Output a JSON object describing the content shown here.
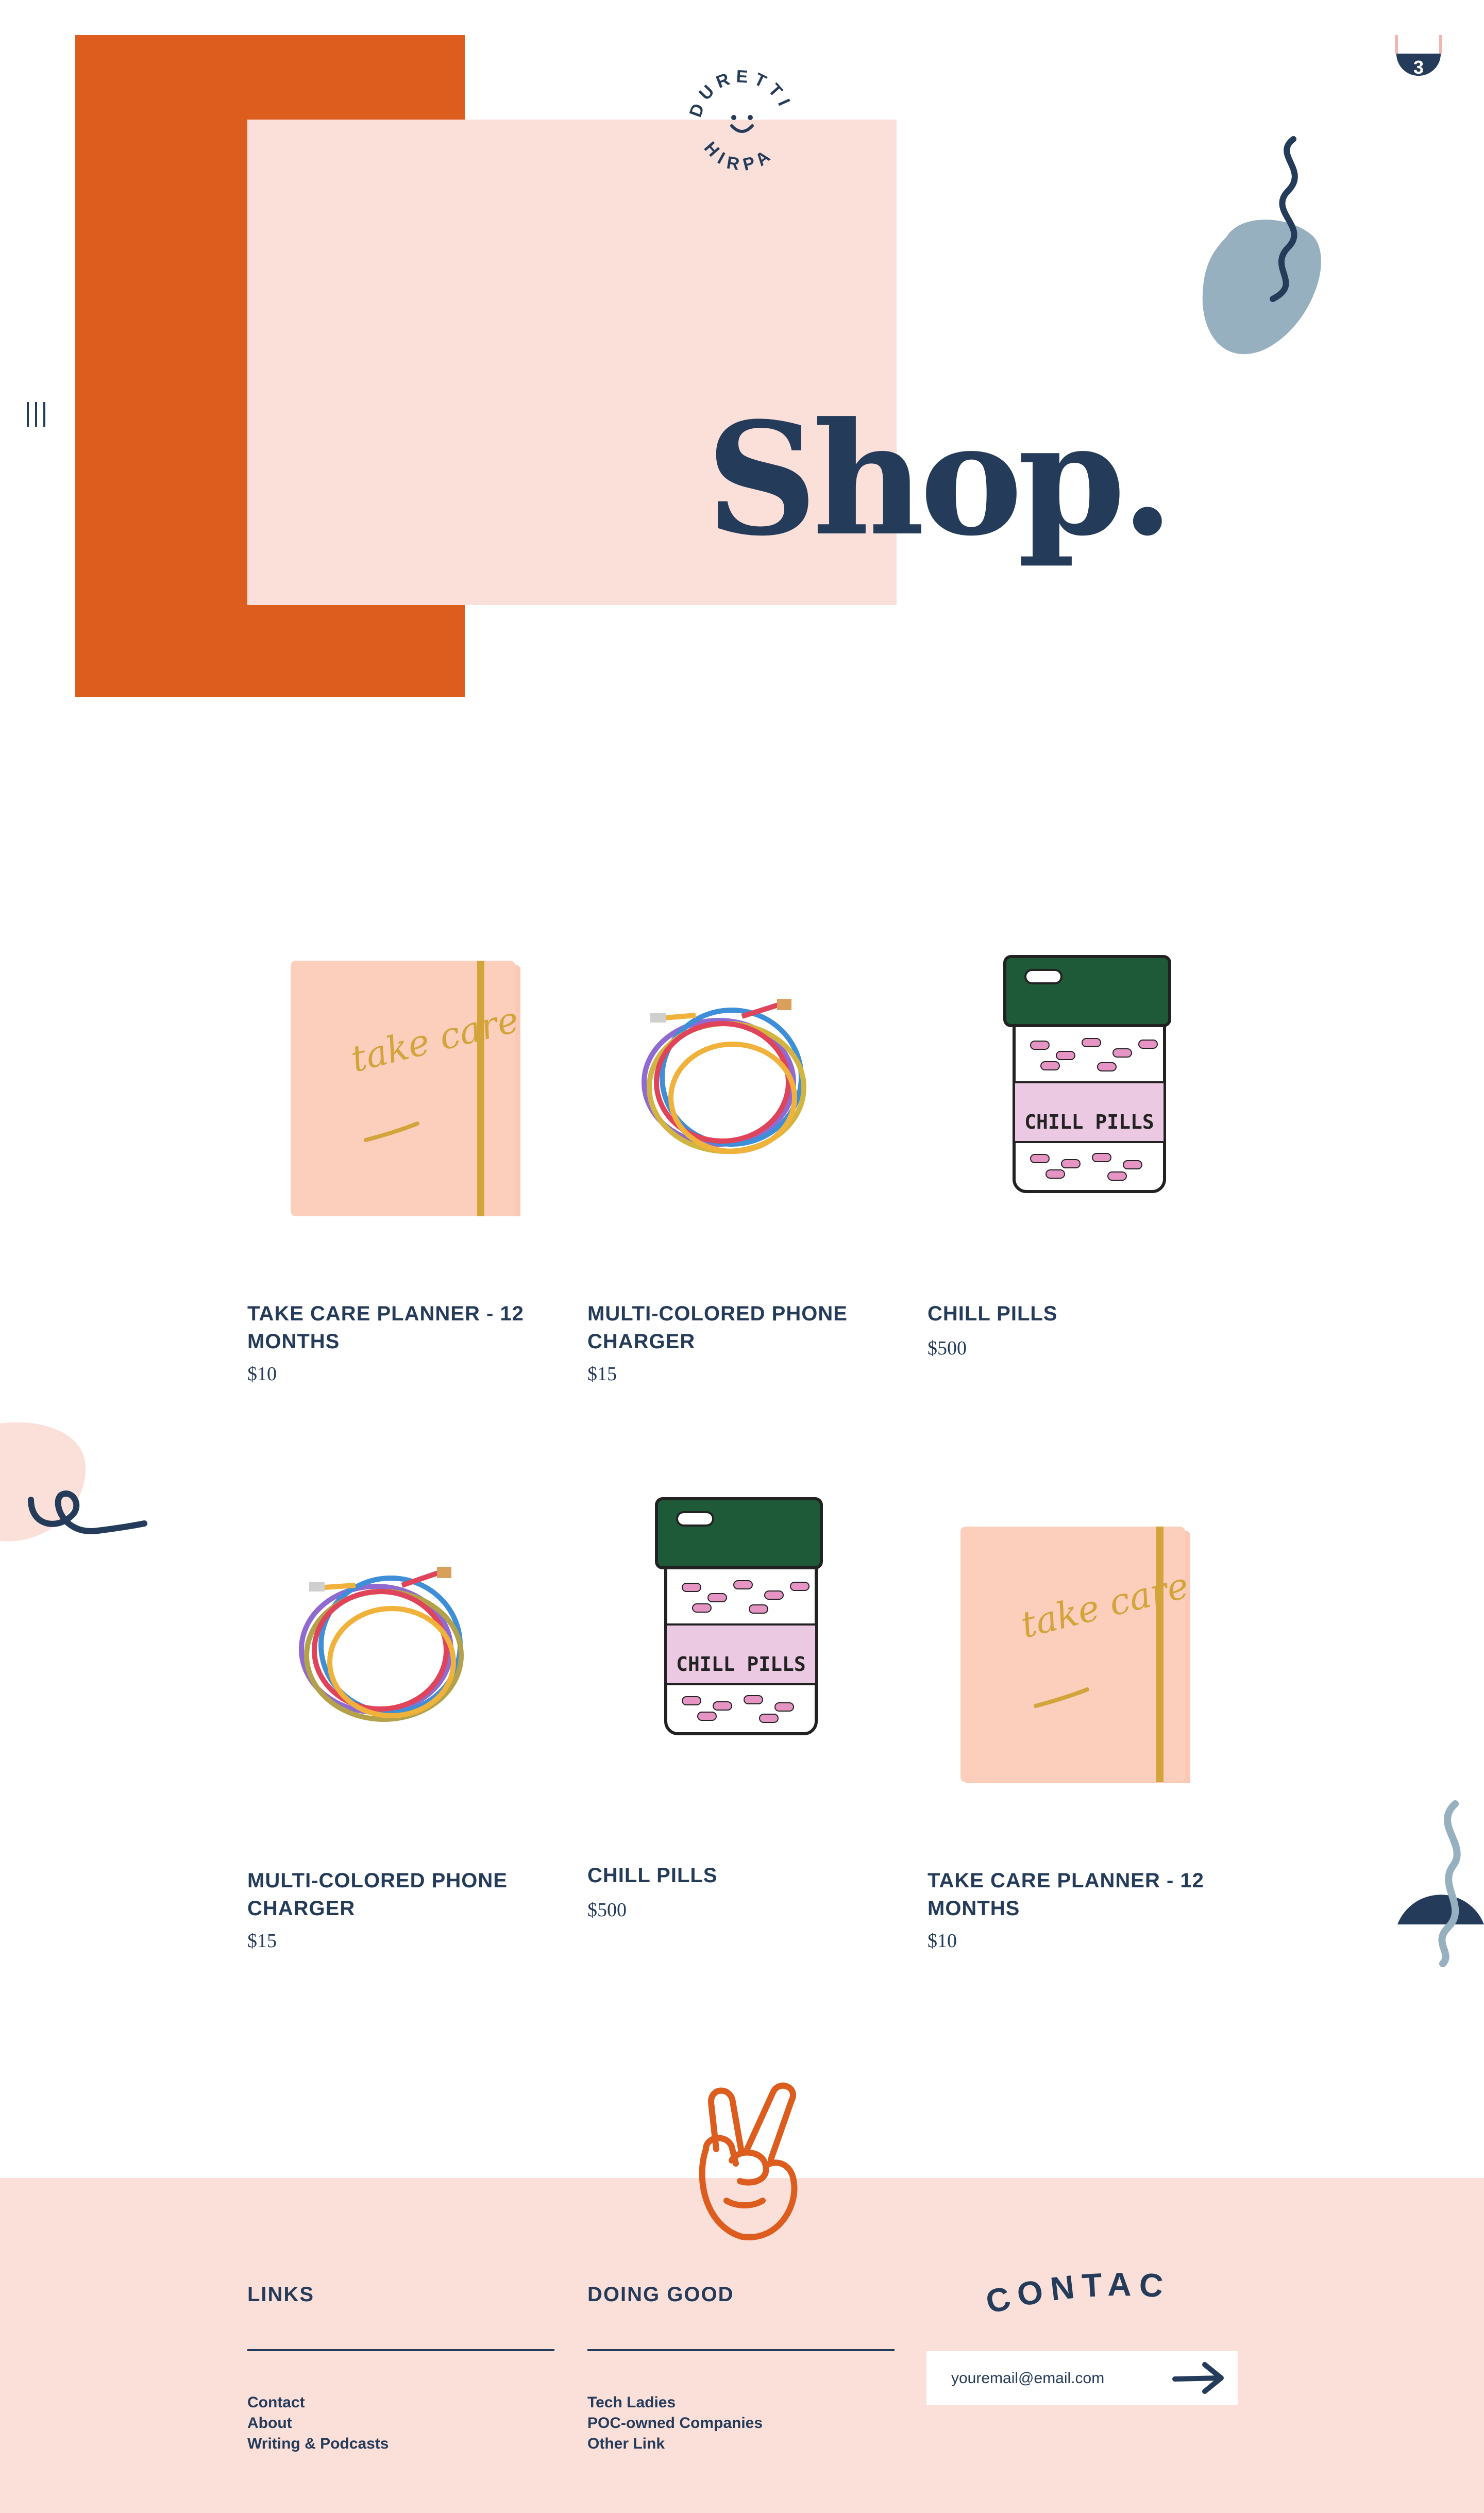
{
  "brand": {
    "logo_text": "DURETTI HIRPA"
  },
  "header": {
    "cart_count": "3",
    "title": "Shop."
  },
  "products": [
    {
      "name": "TAKE CARE PLANNER - 12 MONTHS",
      "price": "$10",
      "art_text": "take care"
    },
    {
      "name": "MULTI-COLORED PHONE CHARGER",
      "price": "$15"
    },
    {
      "name": "CHILL PILLS",
      "price": "$500",
      "art_text": "CHILL PILLS"
    },
    {
      "name": "MULTI-COLORED PHONE CHARGER",
      "price": "$15"
    },
    {
      "name": "CHILL PILLS",
      "price": "$500",
      "art_text": "CHILL PILLS"
    },
    {
      "name": "TAKE CARE PLANNER - 12 MONTHS",
      "price": "$10",
      "art_text": "take care"
    }
  ],
  "footer": {
    "links_heading": "LINKS",
    "links": [
      "Contact",
      "About",
      "Writing & Podcasts"
    ],
    "good_heading": "DOING GOOD",
    "good_links": [
      "Tech Ladies",
      "POC-owned Companies",
      "Other Link"
    ],
    "contact_heading": "CONTACT",
    "email_placeholder": "youremail@email.com"
  },
  "colors": {
    "navy": "#243b5a",
    "orange": "#dc5d1e",
    "blush": "#fbe0da",
    "dusty_blue": "#97b0c0"
  }
}
